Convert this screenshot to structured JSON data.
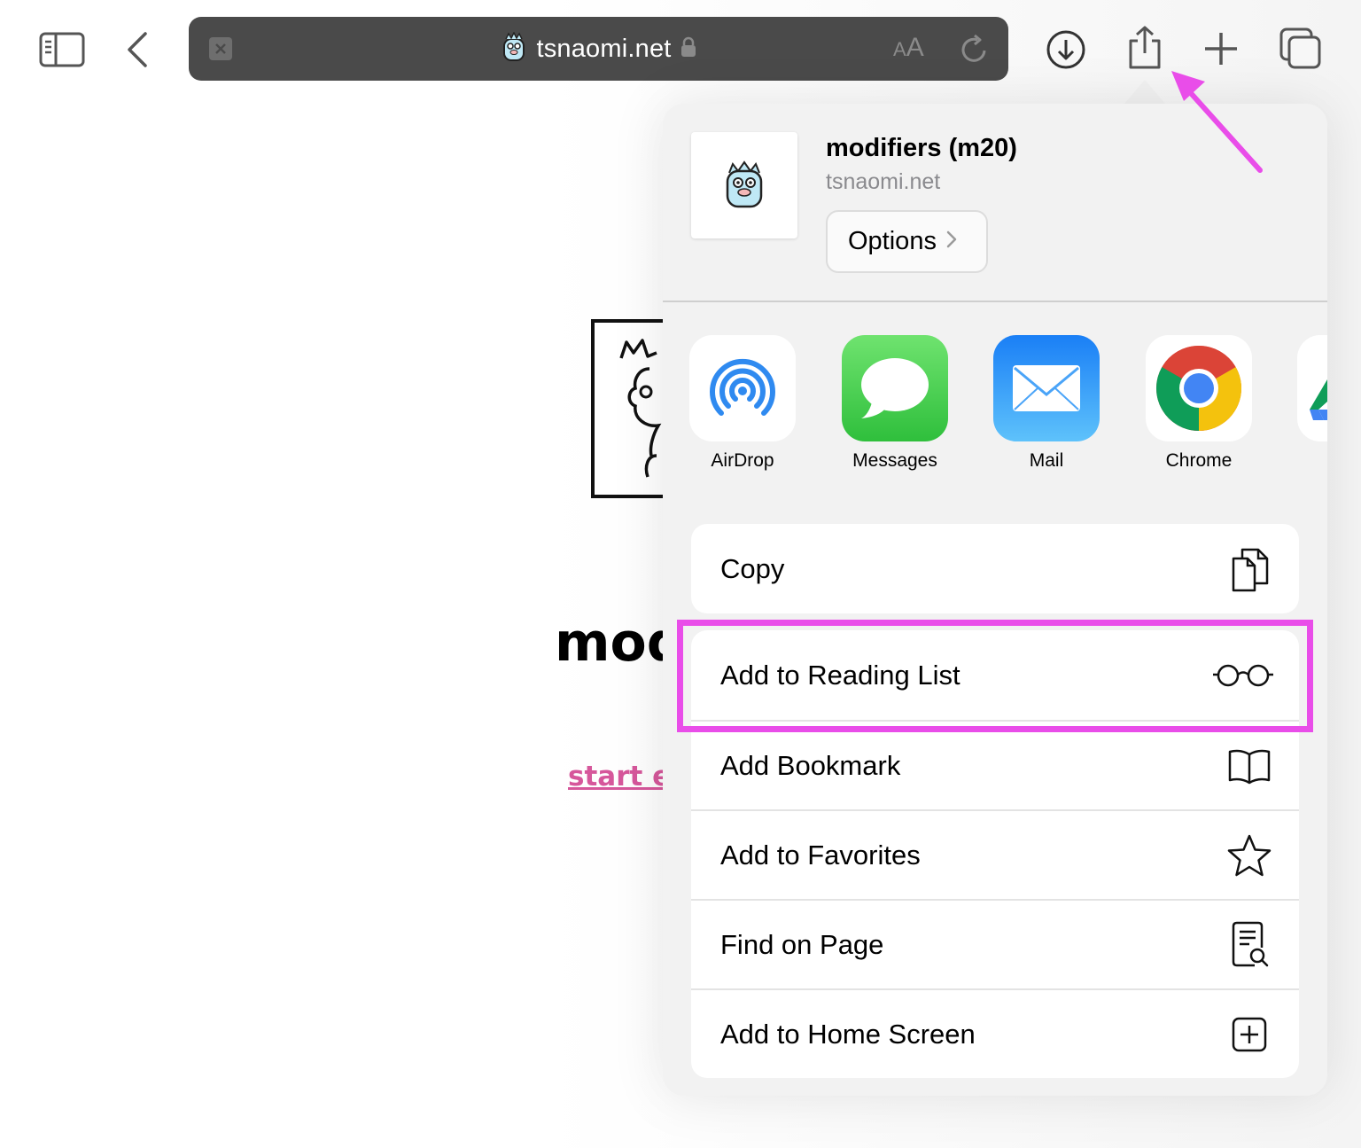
{
  "toolbar": {
    "url": "tsnaomi.net",
    "reader_label_big": "A",
    "reader_label_small": "A",
    "icons": [
      "sidebar-icon",
      "back-icon",
      "close-tab-icon",
      "lock-icon",
      "reload-icon",
      "download-icon",
      "share-icon",
      "new-tab-icon",
      "tabs-overview-icon"
    ]
  },
  "page": {
    "heading": "mod",
    "link": "start ex"
  },
  "share_sheet": {
    "title": "modifiers (m20)",
    "subtitle": "tsnaomi.net",
    "options_label": "Options",
    "apps": [
      {
        "label": "AirDrop",
        "icon": "airdrop-icon"
      },
      {
        "label": "Messages",
        "icon": "messages-icon"
      },
      {
        "label": "Mail",
        "icon": "mail-icon"
      },
      {
        "label": "Chrome",
        "icon": "chrome-icon"
      }
    ],
    "copy_label": "Copy",
    "actions": [
      {
        "label": "Add to Reading List",
        "icon": "glasses-icon"
      },
      {
        "label": "Add Bookmark",
        "icon": "book-icon"
      },
      {
        "label": "Add to Favorites",
        "icon": "star-icon"
      },
      {
        "label": "Find on Page",
        "icon": "find-on-page-icon"
      },
      {
        "label": "Add to Home Screen",
        "icon": "add-square-icon"
      }
    ]
  },
  "annotation": {
    "highlight_color": "#e94de9",
    "arrow_color": "#e94de9"
  },
  "colors": {
    "address_bar": "#4a4a4a",
    "link": "#d6579b",
    "sheet_bg": "#f2f2f2"
  }
}
